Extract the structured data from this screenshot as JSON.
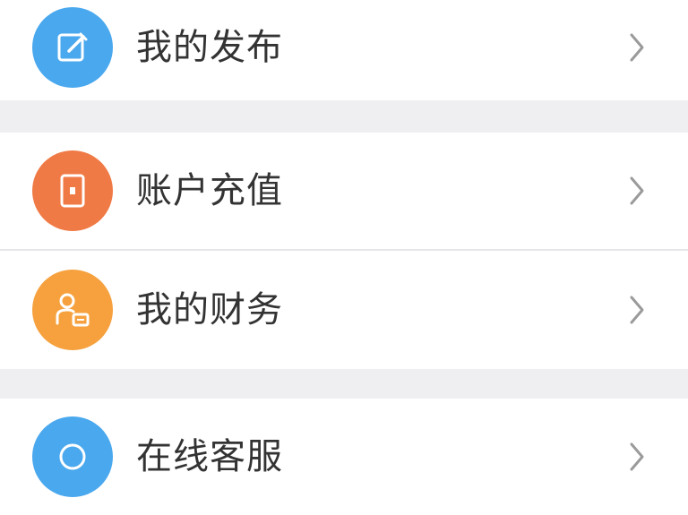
{
  "menu": {
    "items": [
      {
        "label": "我的发布",
        "icon": "edit-icon",
        "color": "#4aa8ee"
      },
      {
        "label": "账户充值",
        "icon": "wallet-icon",
        "color": "#f07a45"
      },
      {
        "label": "我的财务",
        "icon": "finance-icon",
        "color": "#f6a13e"
      },
      {
        "label": "在线客服",
        "icon": "service-icon",
        "color": "#4aa8ee"
      }
    ]
  },
  "colors": {
    "background": "#efeff2",
    "row": "#ffffff",
    "text": "#333333",
    "chevron": "#9a9a9a"
  }
}
